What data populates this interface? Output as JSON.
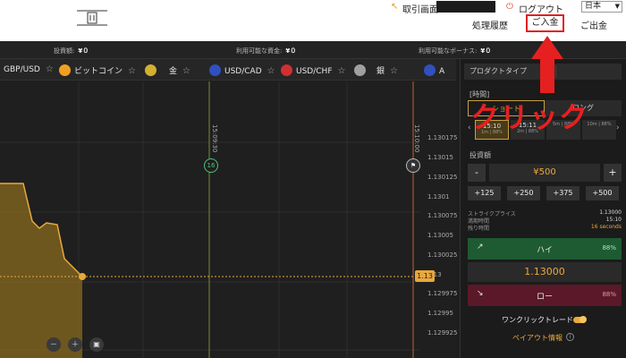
{
  "header": {
    "trade_screen": "取引画面",
    "logout": "ログアウト",
    "language": "日本",
    "nav": {
      "history": "処理履歴",
      "deposit": "ご入金",
      "withdraw": "ご出金"
    }
  },
  "balances": [
    {
      "label": "投資額:",
      "value": "¥０"
    },
    {
      "label": "利用可能な資金:",
      "value": "¥０"
    },
    {
      "label": "利用可能なボーナス:",
      "value": "¥０"
    }
  ],
  "assets": [
    {
      "label": "GBP/USD",
      "icon": "none"
    },
    {
      "label": "ビットコイン",
      "icon": "bitcoin-icon",
      "color": "#f0a020"
    },
    {
      "label": "金",
      "icon": "gold-icon",
      "color": "#d4b030"
    },
    {
      "label": "USD/CAD",
      "icon": "flag-icon",
      "color": "#3050c0"
    },
    {
      "label": "USD/CHF",
      "icon": "flag-icon",
      "color": "#d03030"
    },
    {
      "label": "銀",
      "icon": "silver-icon",
      "color": "#a0a0a0"
    },
    {
      "label": "A",
      "icon": "flag-icon",
      "color": "#3050c0"
    }
  ],
  "chart": {
    "price_levels": [
      "1.130175",
      "1.13015",
      "1.130125",
      "1.1301",
      "1.130075",
      "1.13005",
      "1.130025",
      "1.13",
      "1.129975",
      "1.12995",
      "1.129925"
    ],
    "current_price_tag": "1.13",
    "time_marker_1": "15:09:30",
    "time_marker_2": "15:10:00",
    "countdown": "16",
    "controls": {
      "zoom_out": "－",
      "zoom_in": "＋",
      "screenshot": "▣"
    }
  },
  "panel": {
    "product_type": "プロダクトタイプ",
    "period_label": "[時間]",
    "tabs": {
      "short": "ショート",
      "long": "ロング"
    },
    "slots": [
      {
        "time": "15:10",
        "sub": "1m | 88%"
      },
      {
        "time": "15:11",
        "sub": "2m | 88%"
      },
      {
        "time": "",
        "sub": "5m | 88%"
      },
      {
        "time": "",
        "sub": "10m | 88%"
      }
    ],
    "amount_label": "投資額",
    "amount": "¥500",
    "minus": "-",
    "plus": "+",
    "quick_amounts": [
      "+125",
      "+250",
      "+375",
      "+500"
    ],
    "strike_label": "ストライクプライス",
    "strike_value": "1.13000",
    "expiry_label": "満期時間",
    "expiry_value": "15:10",
    "remaining_label": "残り時間",
    "remaining_value": "16 seconds",
    "high_label": "ハイ",
    "high_pct": "88%",
    "current_price": "1.13000",
    "low_label": "ロー",
    "low_pct": "88%",
    "one_click": "ワンクリックトレード",
    "payout": "ペイアウト情報",
    "payout_info": "i"
  },
  "annotation": {
    "text": "クリック",
    "color": "#e62020"
  }
}
